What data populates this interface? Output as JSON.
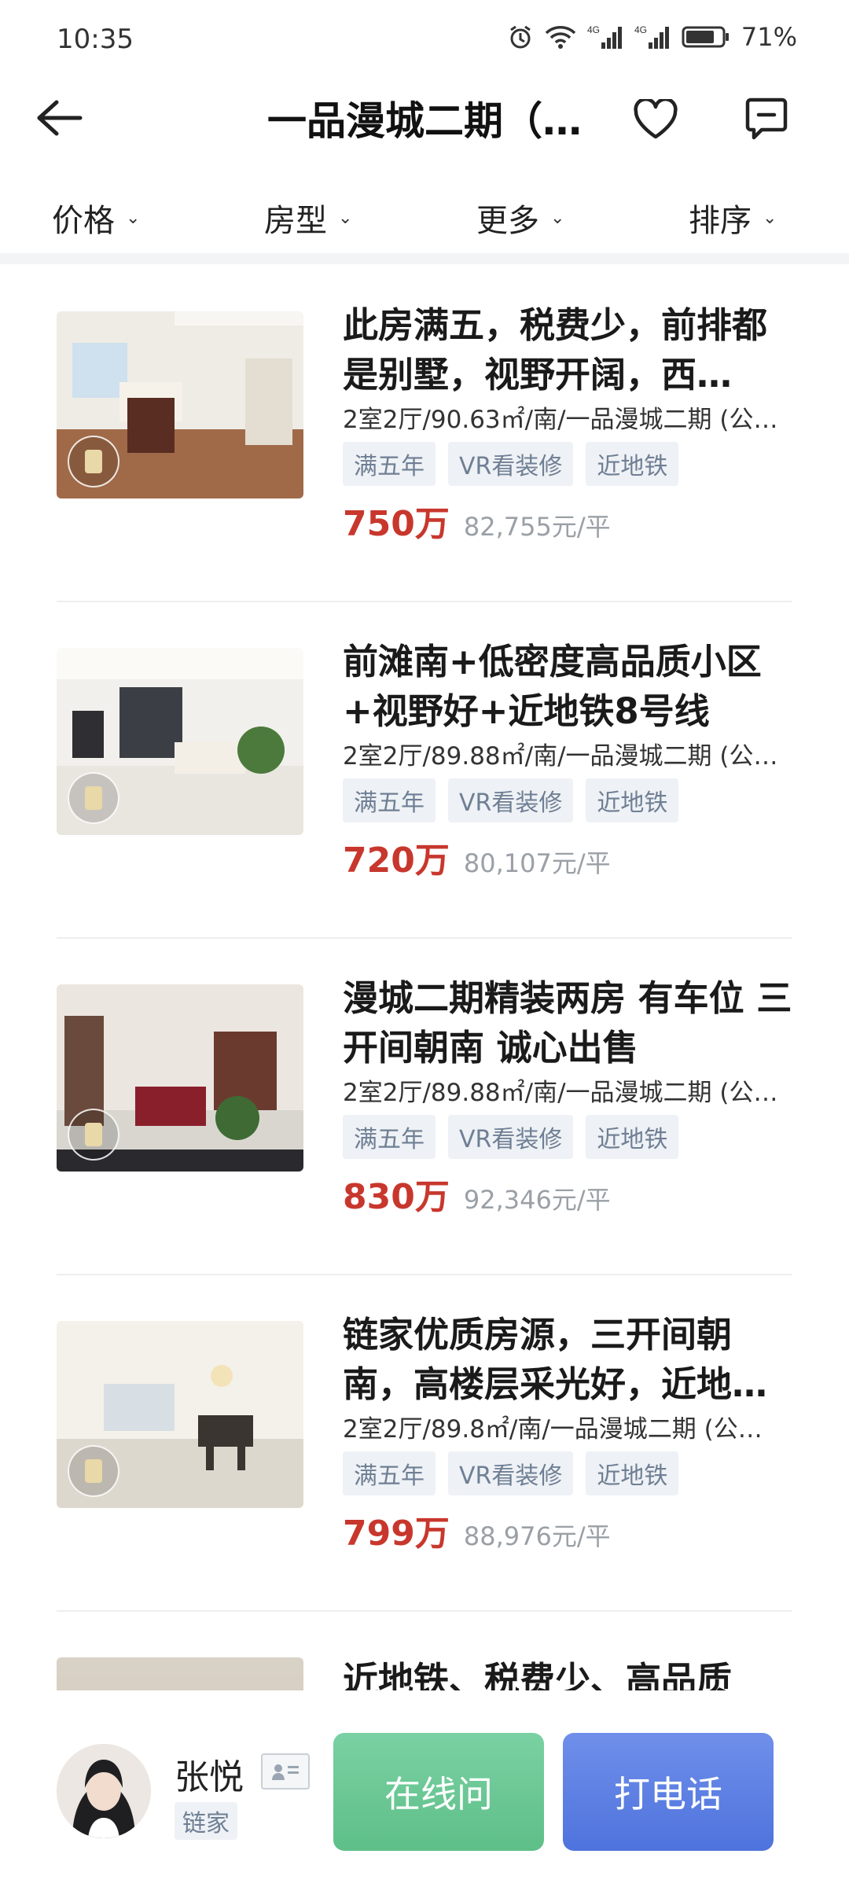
{
  "status_bar": {
    "time": "10:35",
    "battery_percent": "71%",
    "network_labels": [
      "4G",
      "4G"
    ]
  },
  "header": {
    "title": "一品漫城二期（…",
    "icons": {
      "back": "back-arrow-icon",
      "favorite": "heart-icon",
      "message": "message-icon"
    }
  },
  "filters": [
    {
      "label": "价格"
    },
    {
      "label": "房型"
    },
    {
      "label": "更多"
    },
    {
      "label": "排序"
    }
  ],
  "listings": [
    {
      "title": "此房满五，税费少，前排都是别墅，视野开阔，西…",
      "meta": "2室2厅/90.63㎡/南/一品漫城二期 (公…",
      "tags": [
        "满五年",
        "VR看装修",
        "近地铁"
      ],
      "price": "750万",
      "unit_price": "82,755元/平"
    },
    {
      "title": "前滩南+低密度高品质小区+视野好+近地铁8号线",
      "meta": "2室2厅/89.88㎡/南/一品漫城二期 (公…",
      "tags": [
        "满五年",
        "VR看装修",
        "近地铁"
      ],
      "price": "720万",
      "unit_price": "80,107元/平"
    },
    {
      "title": "漫城二期精装两房 有车位 三开间朝南 诚心出售",
      "meta": "2室2厅/89.88㎡/南/一品漫城二期 (公…",
      "tags": [
        "满五年",
        "VR看装修",
        "近地铁"
      ],
      "price": "830万",
      "unit_price": "92,346元/平"
    },
    {
      "title": "链家优质房源，三开间朝南，高楼层采光好，近地…",
      "meta": "2室2厅/89.8㎡/南/一品漫城二期 (公…",
      "tags": [
        "满五年",
        "VR看装修",
        "近地铁"
      ],
      "price": "799万",
      "unit_price": "88,976元/平"
    }
  ],
  "partial_listing": {
    "title": "近地铁、税费少、高品质"
  },
  "agent": {
    "name": "张悦",
    "company": "链家",
    "chat_label": "在线问",
    "call_label": "打电话"
  },
  "colors": {
    "price": "#c8372d",
    "chat_button": "#5ebf88",
    "call_button": "#4f73dd",
    "tag_bg": "#eef1f5"
  }
}
